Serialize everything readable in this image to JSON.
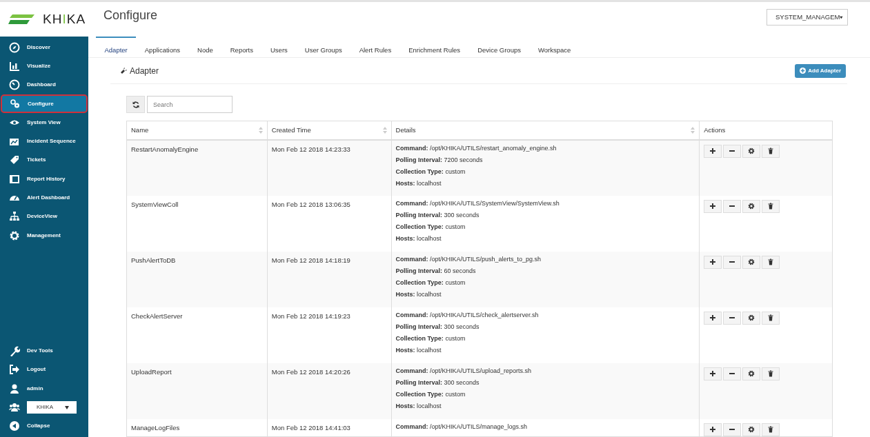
{
  "logo": {
    "text": "KHIKA"
  },
  "page_title": "Configure",
  "workspace_select": {
    "value": "SYSTEM_MANAGEM"
  },
  "sidebar": {
    "items": [
      {
        "label": "Discover",
        "selected": false
      },
      {
        "label": "Visualize",
        "selected": false
      },
      {
        "label": "Dashboard",
        "selected": false
      },
      {
        "label": "Configure",
        "selected": true
      },
      {
        "label": "System View",
        "selected": false
      },
      {
        "label": "Incident Sequence",
        "selected": false
      },
      {
        "label": "Tickets",
        "selected": false
      },
      {
        "label": "Report History",
        "selected": false
      },
      {
        "label": "Alert Dashboard",
        "selected": false
      },
      {
        "label": "DeviceView",
        "selected": false
      },
      {
        "label": "Management",
        "selected": false
      }
    ],
    "bottom_items": [
      {
        "kind": "link",
        "label": "Dev Tools"
      },
      {
        "kind": "link",
        "label": "Logout"
      },
      {
        "kind": "link",
        "label": "admin"
      },
      {
        "kind": "select",
        "value": "KHIKA"
      },
      {
        "kind": "link",
        "label": "Collapse"
      }
    ]
  },
  "tabs": [
    {
      "label": "Adapter",
      "selected": true
    },
    {
      "label": "Applications",
      "selected": false
    },
    {
      "label": "Node",
      "selected": false
    },
    {
      "label": "Reports",
      "selected": false
    },
    {
      "label": "Users",
      "selected": false
    },
    {
      "label": "User Groups",
      "selected": false
    },
    {
      "label": "Alert Rules",
      "selected": false
    },
    {
      "label": "Enrichment Rules",
      "selected": false
    },
    {
      "label": "Device Groups",
      "selected": false
    },
    {
      "label": "Workspace",
      "selected": false
    }
  ],
  "panel": {
    "title": "Adapter",
    "add_button": "Add Adapter",
    "search": {
      "placeholder": "Search"
    }
  },
  "table": {
    "columns": [
      {
        "label": "Name",
        "sortable": true
      },
      {
        "label": "Created Time",
        "sortable": true
      },
      {
        "label": "Details",
        "sortable": true
      },
      {
        "label": "Actions",
        "sortable": false
      }
    ],
    "rows": [
      {
        "name": "RestartAnomalyEngine",
        "created": "Mon Feb 12 2018 14:23:33",
        "details": [
          "**Command:** /opt/KHIKA/UTILS/restart_anomaly_engine.sh",
          "**Polling Interval:** 7200 seconds",
          "**Collection Type:** custom",
          "**Hosts:** localhost"
        ]
      },
      {
        "name": "SystemViewColl",
        "created": "Mon Feb 12 2018 13:06:35",
        "details": [
          "**Command:** /opt/KHIKA/UTILS/SystemView/SystemView.sh",
          "**Polling Interval:** 300 seconds",
          "**Collection Type:** custom",
          "**Hosts:** localhost"
        ]
      },
      {
        "name": "PushAlertToDB",
        "created": "Mon Feb 12 2018 14:18:19",
        "details": [
          "**Command:** /opt/KHIKA/UTILS/push_alerts_to_pg.sh",
          "**Polling Interval:** 60 seconds",
          "**Collection Type:** custom",
          "**Hosts:** localhost"
        ]
      },
      {
        "name": "CheckAlertServer",
        "created": "Mon Feb 12 2018 14:19:23",
        "details": [
          "**Command:** /opt/KHIKA/UTILS/check_alertserver.sh",
          "**Polling Interval:** 300 seconds",
          "**Collection Type:** custom",
          "**Hosts:** localhost"
        ]
      },
      {
        "name": "UploadReport",
        "created": "Mon Feb 12 2018 14:20:26",
        "details": [
          "**Command:** /opt/KHIKA/UTILS/upload_reports.sh",
          "**Polling Interval:** 300 seconds",
          "**Collection Type:** custom",
          "**Hosts:** localhost"
        ]
      },
      {
        "name": "ManageLogFiles",
        "created": "Mon Feb 12 2018 14:41:03",
        "details": [
          "**Command:** /opt/KHIKA/UTILS/manage_logs.sh"
        ]
      }
    ]
  }
}
